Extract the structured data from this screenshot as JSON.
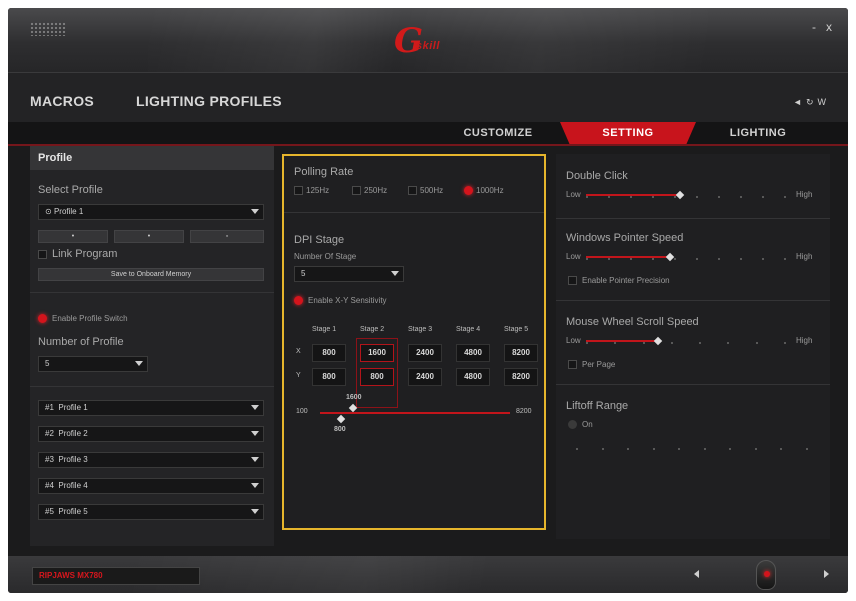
{
  "window": {
    "controls": [
      "-",
      "x"
    ],
    "logo_text": "skill"
  },
  "nav": {
    "items": [
      "MACROS",
      "LIGHTING PROFILES"
    ],
    "right_icons": [
      "prev-icon",
      "refresh-icon",
      "w-icon"
    ]
  },
  "tabs": {
    "items": [
      "CUSTOMIZE",
      "SETTING",
      "LIGHTING"
    ],
    "active": "SETTING",
    "accent": "#c8141c"
  },
  "sidebar": {
    "header": "Profile",
    "select_profile_label": "Select Profile",
    "profile_selected": "Profile 1",
    "link_program_label": "Link Program",
    "save_button": "Save to Onboard Memory",
    "enable_switch_label": "Enable Profile Switch",
    "number_of_profile_label": "Number of Profile",
    "number_of_profile_value": "5",
    "profiles": [
      {
        "num": "#1",
        "name": "Profile 1"
      },
      {
        "num": "#2",
        "name": "Profile 2"
      },
      {
        "num": "#3",
        "name": "Profile 3"
      },
      {
        "num": "#4",
        "name": "Profile 4"
      },
      {
        "num": "#5",
        "name": "Profile 5"
      }
    ]
  },
  "center": {
    "polling_rate_title": "Polling Rate",
    "polling_rates": [
      "125Hz",
      "250Hz",
      "500Hz",
      "1000Hz"
    ],
    "polling_selected": "1000Hz",
    "dpi_title": "DPI Stage",
    "number_of_stage_label": "Number Of Stage",
    "number_of_stage_value": "5",
    "enable_xy_label": "Enable X-Y Sensitivity",
    "stage_headers": [
      "Stage 1",
      "Stage 2",
      "Stage 3",
      "Stage 4",
      "Stage 5"
    ],
    "x_label": "X",
    "y_label": "Y",
    "x_values": [
      "800",
      "1600",
      "2400",
      "4800",
      "8200"
    ],
    "y_values": [
      "800",
      "800",
      "2400",
      "4800",
      "8200"
    ],
    "selected_stage": 2,
    "slider_min": "100",
    "slider_max": "8200",
    "slider_top_value": "1600",
    "slider_bottom_value": "800"
  },
  "right": {
    "double_click_title": "Double Click",
    "windows_pointer_title": "Windows Pointer Speed",
    "enhance_precision_label": "Enable Pointer Precision",
    "mouse_wheel_title": "Mouse Wheel Scroll Speed",
    "per_page_label": "Per Page",
    "liftoff_title": "Liftoff Range",
    "liftoff_option": "On",
    "low_label": "Low",
    "high_label": "High",
    "double_click_level": 0.47,
    "pointer_speed_level": 0.42,
    "wheel_level": 0.36
  },
  "bottom": {
    "device_name": "RIPJAWS MX780"
  }
}
